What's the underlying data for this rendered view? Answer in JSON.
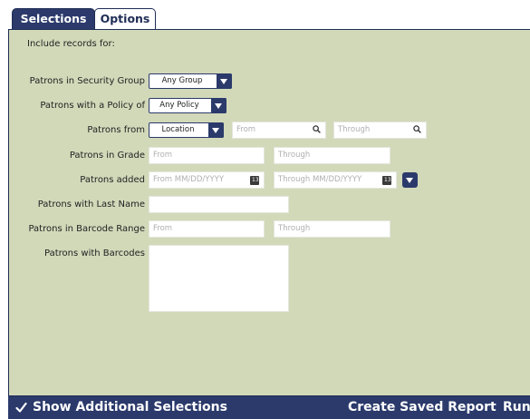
{
  "tabs": {
    "selections": "Selections",
    "options": "Options"
  },
  "include_label": "Include records for:",
  "rows": {
    "security_group": {
      "label": "Patrons in Security Group",
      "value": "Any Group"
    },
    "policy": {
      "label": "Patrons with a Policy of",
      "value": "Any Policy"
    },
    "from": {
      "label": "Patrons from",
      "value": "Location",
      "from_ph": "From",
      "through_ph": "Through"
    },
    "grade": {
      "label": "Patrons in Grade",
      "from_ph": "From",
      "through_ph": "Through"
    },
    "added": {
      "label": "Patrons added",
      "from_ph": "From MM/DD/YYYY",
      "through_ph": "Through MM/DD/YYYY",
      "cal": "13"
    },
    "last_name": {
      "label": "Patrons with Last Name"
    },
    "barcode_range": {
      "label": "Patrons in Barcode Range",
      "from_ph": "From",
      "through_ph": "Through"
    },
    "barcodes": {
      "label": "Patrons with Barcodes"
    }
  },
  "footer": {
    "show_additional": "Show Additional Selections",
    "show_additional_checked": true,
    "create_saved": "Create Saved Report",
    "run": "Run"
  },
  "colors": {
    "accent": "#2b3a6b",
    "panel": "#d2d9b9"
  }
}
